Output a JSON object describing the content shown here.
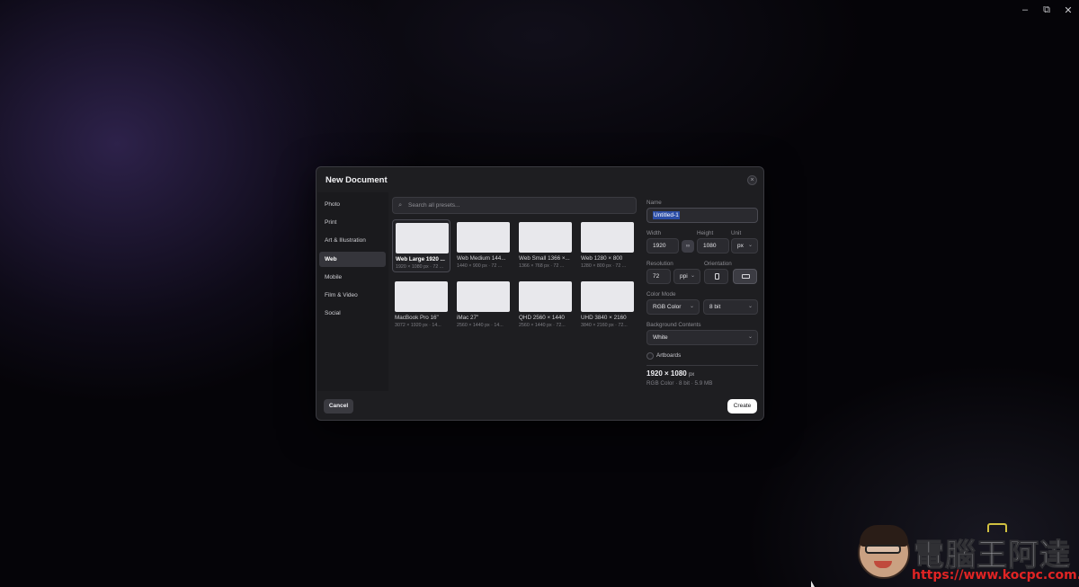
{
  "window_controls": {
    "minimize": "–",
    "restore": "⧉",
    "close": "✕"
  },
  "dialog": {
    "title": "New Document",
    "close_glyph": "×"
  },
  "sidebar": {
    "items": [
      {
        "label": "Photo",
        "active": false
      },
      {
        "label": "Print",
        "active": false
      },
      {
        "label": "Art & Illustration",
        "active": false
      },
      {
        "label": "Web",
        "active": true
      },
      {
        "label": "Mobile",
        "active": false
      },
      {
        "label": "Film & Video",
        "active": false
      },
      {
        "label": "Social",
        "active": false
      }
    ]
  },
  "search": {
    "placeholder": "Search all presets...",
    "icon": "search-icon"
  },
  "presets": [
    {
      "name": "Web Large 1920 ...",
      "dims": "1920 × 1080 px · 72 ...",
      "selected": true
    },
    {
      "name": "Web Medium 144...",
      "dims": "1440 × 900 px · 72 ...",
      "selected": false
    },
    {
      "name": "Web Small 1366 ×...",
      "dims": "1366 × 768 px · 72 ...",
      "selected": false
    },
    {
      "name": "Web 1280 × 800",
      "dims": "1280 × 800 px · 72 ...",
      "selected": false
    },
    {
      "name": "MacBook Pro 16\"",
      "dims": "3072 × 1920 px · 14...",
      "selected": false
    },
    {
      "name": "iMac 27\"",
      "dims": "2560 × 1440 px · 14...",
      "selected": false
    },
    {
      "name": "QHD 2560 × 1440",
      "dims": "2560 × 1440 px · 72...",
      "selected": false
    },
    {
      "name": "UHD 3840 × 2160",
      "dims": "3840 × 2160 px · 72...",
      "selected": false
    }
  ],
  "settings": {
    "name_label": "Name",
    "name_value": "Untitled-1",
    "width_label": "Width",
    "width_value": "1920",
    "height_label": "Height",
    "height_value": "1080",
    "link_glyph": "∞",
    "unit_label": "Unit",
    "unit_value": "px",
    "resolution_label": "Resolution",
    "resolution_value": "72",
    "resolution_unit": "ppi",
    "orientation_label": "Orientation",
    "orientation_selected": "landscape",
    "color_mode_label": "Color Mode",
    "color_mode_value": "RGB Color",
    "bit_depth_value": "8 bit",
    "background_label": "Background Contents",
    "background_value": "White",
    "artboards_label": "Artboards",
    "artboards_checked": false,
    "chevron": "⌄"
  },
  "summary": {
    "size": "1920 × 1080",
    "unit": "px",
    "details": "RGB Color · 8 bit · 5.9 MB"
  },
  "footer": {
    "cancel_label": "Cancel",
    "create_label": "Create"
  },
  "watermark": {
    "text": "電腦王阿達",
    "url": "https://www.kocpc.com.tw/"
  },
  "colors": {
    "selection": "#2d4fa8",
    "dialog_bg": "#1e1e21",
    "create_button": "#ffffff"
  }
}
